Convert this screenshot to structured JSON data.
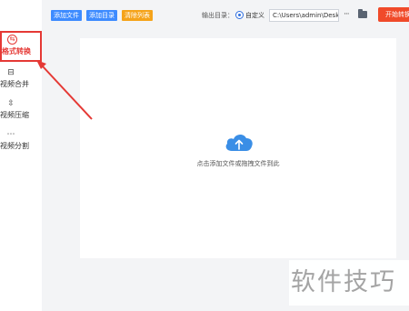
{
  "sidebar": {
    "items": [
      {
        "label": "格式转换",
        "icon": "convert-icon",
        "glyph": "⇆",
        "active": true
      },
      {
        "label": "视频合并",
        "icon": "merge-icon",
        "glyph": "⊟",
        "active": false
      },
      {
        "label": "视频压缩",
        "icon": "compress-icon",
        "glyph": "⇳",
        "active": false
      },
      {
        "label": "视频分割",
        "icon": "split-icon",
        "glyph": "⋯",
        "active": false
      }
    ]
  },
  "toolbar": {
    "add_file_label": "添加文件",
    "add_folder_label": "添加目录",
    "clear_list_label": "清除列表",
    "output_dir_label": "输出目录：",
    "custom_option_label": "自定义",
    "path_value": "C:\\Users\\admin\\Deskto",
    "more_label": "···",
    "start_label": "开始转换"
  },
  "dropzone": {
    "hint": "点击添加文件或拖拽文件到此"
  },
  "watermark": {
    "text": "软件技巧"
  },
  "colors": {
    "accent_red": "#e53935",
    "button_blue": "#3d8bff",
    "button_orange": "#f5a31a",
    "start_red": "#f04a2a",
    "cloud_blue": "#3a8ee6"
  }
}
